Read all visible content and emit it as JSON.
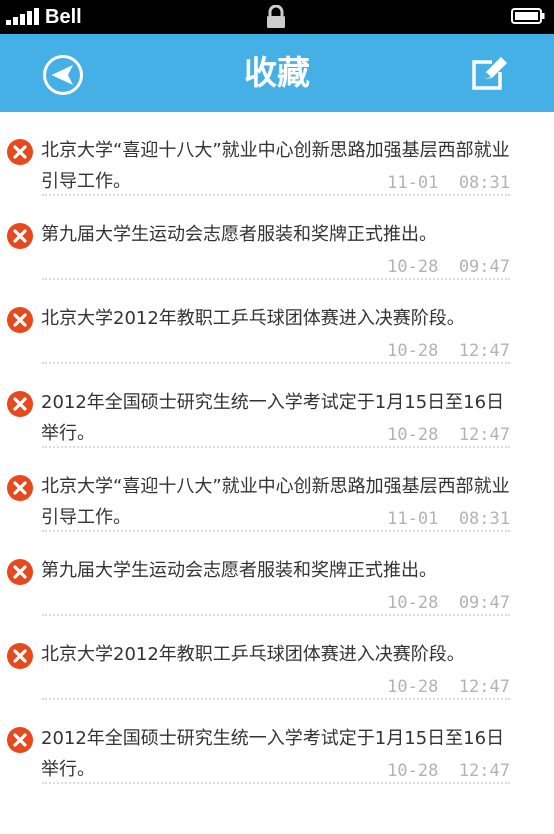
{
  "status_bar": {
    "carrier": "Bell",
    "icons": [
      "signal-icon",
      "lock-icon",
      "battery-icon"
    ]
  },
  "header": {
    "title": "收藏",
    "back_icon": "back-arrow-icon",
    "edit_icon": "edit-icon",
    "color": "#45b0e6"
  },
  "favorites": {
    "delete_icon": "delete-icon",
    "delete_color": "#e8481e",
    "items": [
      {
        "title": "北京大学“喜迎十八大”就业中心创新思路加强基层西部就业引导工作。",
        "time": "11-01  08:31"
      },
      {
        "title": "第九届大学生运动会志愿者服装和奖牌正式推出。",
        "time": "10-28  09:47"
      },
      {
        "title": "北京大学2012年教职工乒乓球团体赛进入决赛阶段。",
        "time": "10-28  12:47"
      },
      {
        "title": "2012年全国硕士研究生统一入学考试定于1月15日至16日举行。",
        "time": "10-28  12:47"
      },
      {
        "title": "北京大学“喜迎十八大”就业中心创新思路加强基层西部就业引导工作。",
        "time": "11-01  08:31"
      },
      {
        "title": "第九届大学生运动会志愿者服装和奖牌正式推出。",
        "time": "10-28  09:47"
      },
      {
        "title": "北京大学2012年教职工乒乓球团体赛进入决赛阶段。",
        "time": "10-28  12:47"
      },
      {
        "title": "2012年全国硕士研究生统一入学考试定于1月15日至16日举行。",
        "time": "10-28  12:47"
      }
    ]
  }
}
